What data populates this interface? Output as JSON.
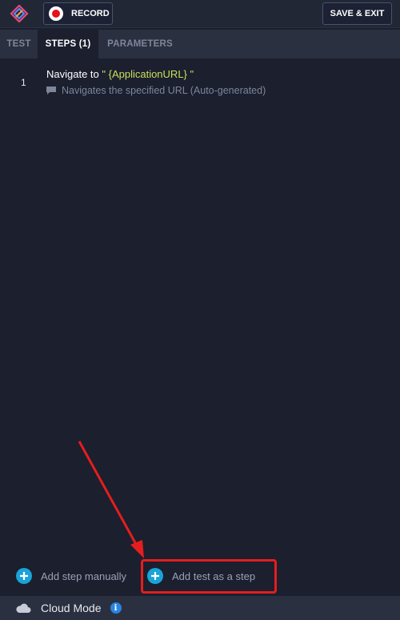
{
  "toolbar": {
    "logo_icon": "app-logo-icon",
    "record_label": "RECORD",
    "save_exit_label": "SAVE & EXIT"
  },
  "tabs": [
    {
      "label": "TEST",
      "active": false
    },
    {
      "label": "STEPS (1)",
      "active": true
    },
    {
      "label": "PARAMETERS",
      "active": false
    }
  ],
  "steps": [
    {
      "number": "1",
      "title_prefix": "Navigate to ",
      "param": "\" {ApplicationURL} \"",
      "description": "Navigates the specified URL (Auto-generated)"
    }
  ],
  "actions": {
    "add_manual_label": "Add step manually",
    "add_test_label": "Add test as a step"
  },
  "footer": {
    "mode_label": "Cloud Mode",
    "info_icon": "info-icon"
  },
  "colors": {
    "background": "#1b1f2e",
    "accent_blue": "#1aa3d9",
    "param_green": "#c8e05a",
    "highlight_red": "#e41e1e",
    "record_red": "#e3121b"
  }
}
